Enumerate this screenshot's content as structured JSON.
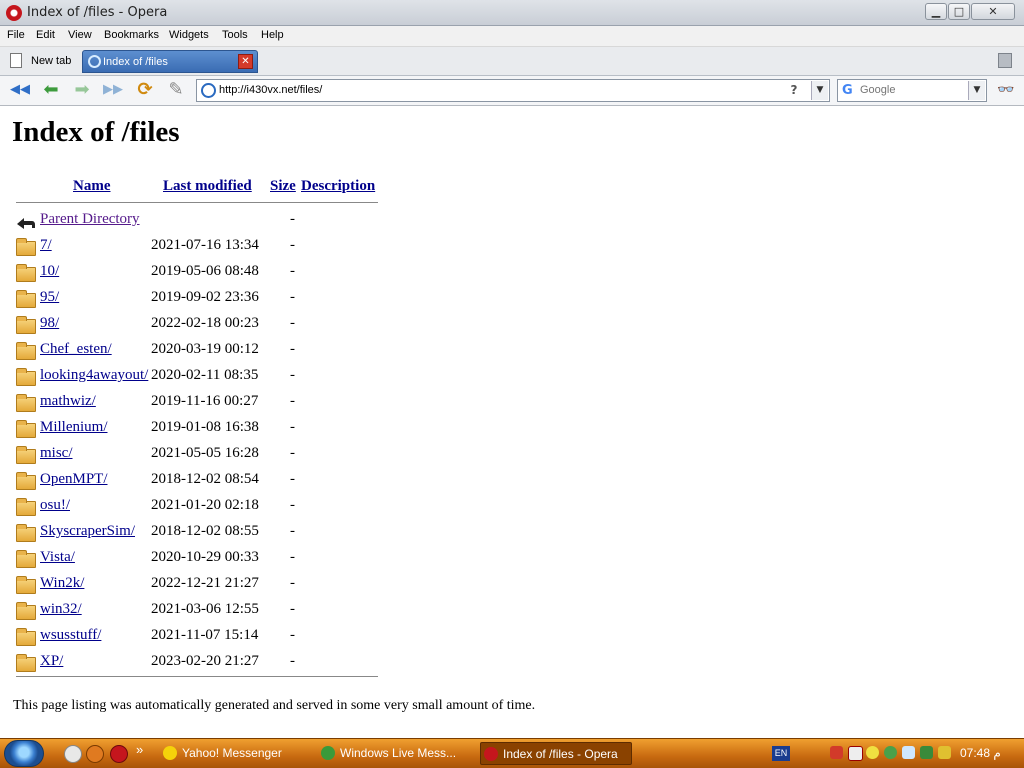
{
  "window": {
    "title": "Index of /files - Opera",
    "minimize_glyph": "▁",
    "maximize_glyph": "□",
    "close_glyph": "✕"
  },
  "menu": [
    "File",
    "Edit",
    "View",
    "Bookmarks",
    "Widgets",
    "Tools",
    "Help"
  ],
  "tabs": {
    "new_tab_label": "New tab",
    "active_tab_label": "Index of /files",
    "close_glyph": "✕"
  },
  "nav": {
    "address": "http://i430vx.net/files/",
    "help_glyph": "?",
    "dropdown_glyph": "▼",
    "search_placeholder": "Google",
    "search_engine_glyph": "G",
    "zoom_glyph": "👓",
    "back_glyph": "◀◀",
    "prev_glyph": "⬅",
    "next_glyph": "➡",
    "forward_glyph": "▶▶",
    "reload_glyph": "⟳",
    "edit_glyph": "✎"
  },
  "page": {
    "heading": "Index of /files",
    "columns": {
      "name": "Name",
      "last_modified": "Last modified",
      "size": "Size",
      "description": "Description"
    },
    "parent": {
      "name": "Parent Directory",
      "size": "-"
    },
    "rows": [
      {
        "name": "7/",
        "date": "2021-07-16 13:34",
        "size": "-"
      },
      {
        "name": "10/",
        "date": "2019-05-06 08:48",
        "size": "-"
      },
      {
        "name": "95/",
        "date": "2019-09-02 23:36",
        "size": "-"
      },
      {
        "name": "98/",
        "date": "2022-02-18 00:23",
        "size": "-"
      },
      {
        "name": "Chef_esten/",
        "date": "2020-03-19 00:12",
        "size": "-"
      },
      {
        "name": "looking4awayout/",
        "date": "2020-02-11 08:35",
        "size": "-"
      },
      {
        "name": "mathwiz/",
        "date": "2019-11-16 00:27",
        "size": "-"
      },
      {
        "name": "Millenium/",
        "date": "2019-01-08 16:38",
        "size": "-"
      },
      {
        "name": "misc/",
        "date": "2021-05-05 16:28",
        "size": "-"
      },
      {
        "name": "OpenMPT/",
        "date": "2018-12-02 08:54",
        "size": "-"
      },
      {
        "name": "osu!/",
        "date": "2021-01-20 02:18",
        "size": "-"
      },
      {
        "name": "SkyscraperSim/",
        "date": "2018-12-02 08:55",
        "size": "-"
      },
      {
        "name": "Vista/",
        "date": "2020-10-29 00:33",
        "size": "-"
      },
      {
        "name": "Win2k/",
        "date": "2022-12-21 21:27",
        "size": "-"
      },
      {
        "name": "win32/",
        "date": "2021-03-06 12:55",
        "size": "-"
      },
      {
        "name": "wsusstuff/",
        "date": "2021-11-07 15:14",
        "size": "-"
      },
      {
        "name": "XP/",
        "date": "2023-02-20 21:27",
        "size": "-"
      }
    ],
    "footer": "This page listing was automatically generated and served in some very small amount of time."
  },
  "taskbar": {
    "more_glyph": "»",
    "items": [
      {
        "label": "Yahoo! Messenger",
        "icon_color": "#f5d20a"
      },
      {
        "label": "Windows Live Mess...",
        "icon_color": "#3a9a3a"
      },
      {
        "label": "Index of /files - Opera",
        "icon_color": "#c5161d"
      }
    ],
    "language": "EN",
    "clock": "07:48 م"
  },
  "colors": {
    "link": "#00008b",
    "visited": "#551a8b",
    "taskbar": "#c86a10",
    "tab_active": "#3a6cb3"
  }
}
